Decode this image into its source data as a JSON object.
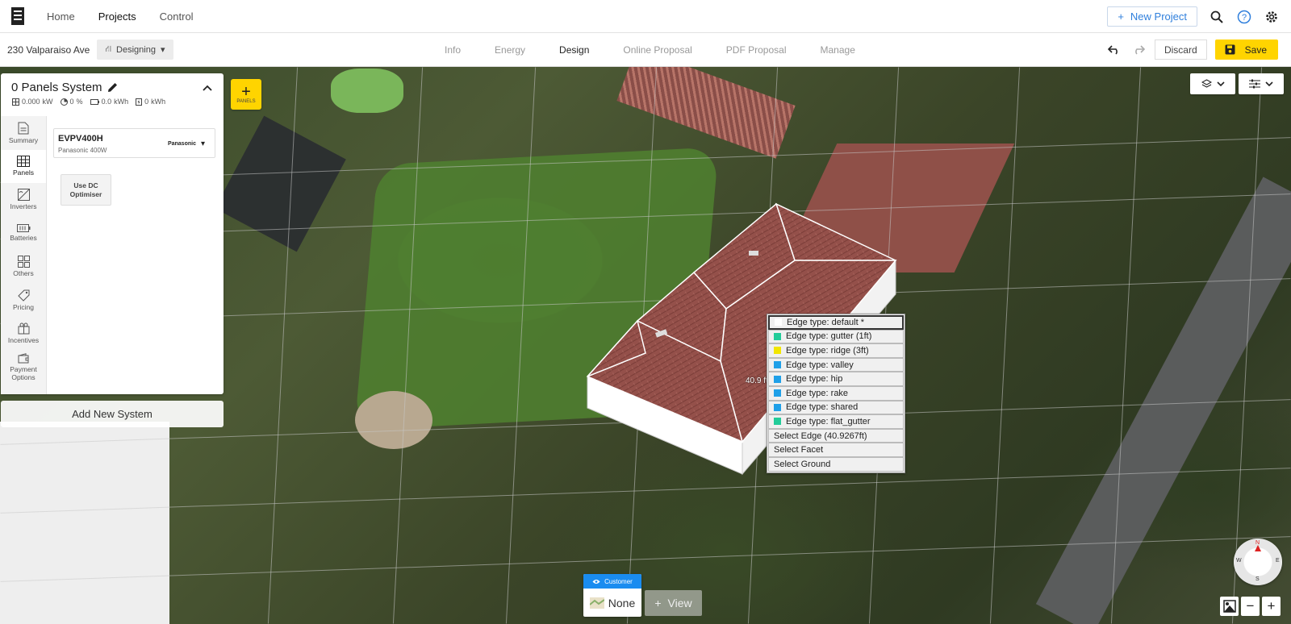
{
  "nav": {
    "items": [
      "Home",
      "Projects",
      "Control"
    ],
    "new_project": "New Project"
  },
  "subbar": {
    "address": "230 Valparaiso Ave",
    "status": "Designing",
    "tabs": [
      "Info",
      "Energy",
      "Design",
      "Online Proposal",
      "PDF Proposal",
      "Manage"
    ],
    "active_tab": "Design",
    "discard": "Discard",
    "save": "Save"
  },
  "system": {
    "title": "0 Panels System",
    "stats": {
      "power": "0.000",
      "power_unit": "kW",
      "offset": "0",
      "offset_unit": "%",
      "battery": "0.0",
      "battery_unit": "kWh",
      "generation": "0",
      "generation_unit": "kWh"
    },
    "side_tabs": [
      "Summary",
      "Panels",
      "Inverters",
      "Batteries",
      "Others",
      "Pricing",
      "Incentives",
      "Payment Options"
    ],
    "active_side_tab": "Panels",
    "product": {
      "name": "EVPV400H",
      "sub": "Panasonic 400W",
      "brand": "Panasonic"
    },
    "optimiser_label": "Use DC Optimiser",
    "add_system": "Add New System"
  },
  "add_panels": {
    "plus": "+",
    "label": "PANELS"
  },
  "measure_label": "40.9 ft",
  "context_menu": {
    "items": [
      {
        "label": "Edge type: default *",
        "color": "#ffffff",
        "selected": true
      },
      {
        "label": "Edge type: gutter (1ft)",
        "color": "#22cc99"
      },
      {
        "label": "Edge type: ridge (3ft)",
        "color": "#f2e600"
      },
      {
        "label": "Edge type: valley",
        "color": "#1fa0e8"
      },
      {
        "label": "Edge type: hip",
        "color": "#1fa0e8"
      },
      {
        "label": "Edge type: rake",
        "color": "#1fa0e8"
      },
      {
        "label": "Edge type: shared",
        "color": "#1fa0e8"
      },
      {
        "label": "Edge type: flat_gutter",
        "color": "#22cc99"
      },
      {
        "label": "Select Edge (40.9267ft)"
      },
      {
        "label": "Select Facet"
      },
      {
        "label": "Select Ground"
      }
    ]
  },
  "view": {
    "header": "Customer",
    "value": "None",
    "add_label": "View"
  },
  "compass": {
    "n": "N",
    "s": "S",
    "e": "E",
    "w": "W"
  },
  "zoom": {
    "minus": "−",
    "plus": "+"
  },
  "colors": {
    "accent": "#ffd400",
    "link": "#2f7fdc",
    "view_header": "#1a8cf0"
  }
}
